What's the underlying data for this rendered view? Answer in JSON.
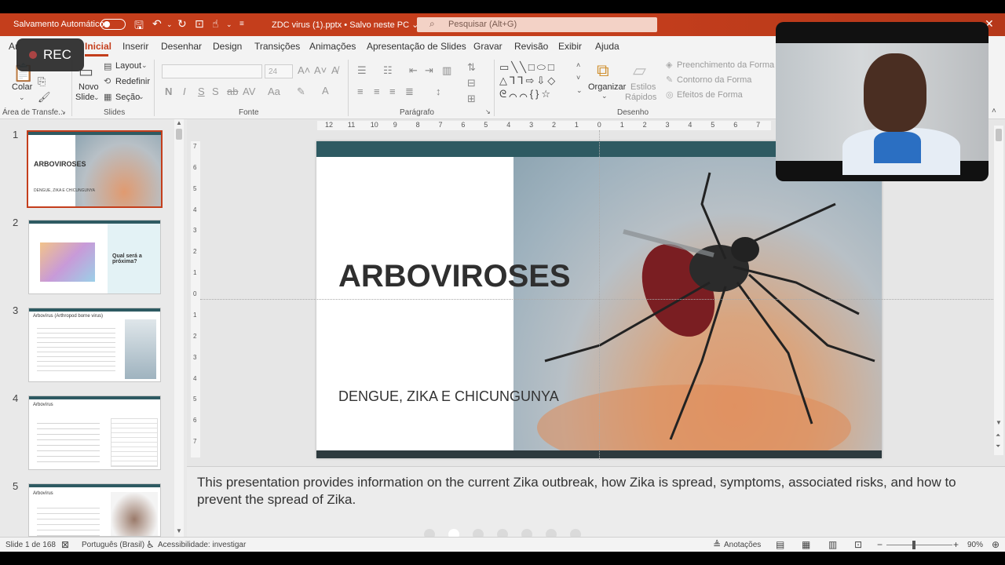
{
  "titlebar": {
    "autosave_label": "Salvamento Automático",
    "filename": "ZDC virus (1).pptx • Salvo neste PC ⌄",
    "search_placeholder": "Pesquisar (Alt+G)"
  },
  "tabs": [
    {
      "label": "Ar"
    },
    {
      "label": "Inicial"
    },
    {
      "label": "Inserir"
    },
    {
      "label": "Desenhar"
    },
    {
      "label": "Design"
    },
    {
      "label": "Transições"
    },
    {
      "label": "Animações"
    },
    {
      "label": "Apresentação de Slides"
    },
    {
      "label": "Gravar"
    },
    {
      "label": "Revisão"
    },
    {
      "label": "Exibir"
    },
    {
      "label": "Ajuda"
    }
  ],
  "ribbon": {
    "clipboard": {
      "paste": "Colar",
      "group": "Área de Transfe..."
    },
    "slides": {
      "new_slide_1": "Novo",
      "new_slide_2": "Slide",
      "layout": "Layout",
      "reset": "Redefinir",
      "section": "Seção",
      "group": "Slides"
    },
    "font": {
      "size": "24",
      "group": "Fonte"
    },
    "paragraph": {
      "group": "Parágrafo"
    },
    "drawing": {
      "organize": "Organizar",
      "quick_styles_1": "Estilos",
      "quick_styles_2": "Rápidos",
      "fill": "Preenchimento da Forma",
      "outline": "Contorno da Forma",
      "effects": "Efeitos de Forma",
      "group": "Desenho"
    }
  },
  "rec_label": "REC",
  "thumbnails": [
    {
      "number": "1",
      "title": "ARBOVIROSES",
      "subtitle": "DENGUE, ZIKA E CHICUNGUNYA"
    },
    {
      "number": "2",
      "title": "Qual será a próxima?"
    },
    {
      "number": "3",
      "title": "Arbovírus (Arthropod borne virus)"
    },
    {
      "number": "4",
      "title": "Arbovírus"
    },
    {
      "number": "5",
      "title": "Arbovírus"
    }
  ],
  "ruler": {
    "h_ticks": [
      "12",
      "11",
      "10",
      "9",
      "8",
      "7",
      "6",
      "5",
      "4",
      "3",
      "2",
      "1",
      "0",
      "1",
      "2",
      "3",
      "4",
      "5",
      "6",
      "7"
    ],
    "v_ticks": [
      "7",
      "6",
      "5",
      "4",
      "3",
      "2",
      "1",
      "0",
      "1",
      "2",
      "3",
      "4",
      "5",
      "6",
      "7"
    ]
  },
  "slide": {
    "title": "ARBOVIROSES",
    "subtitle": "DENGUE, ZIKA E CHICUNGUNYA",
    "colors": {
      "top_bar": "#2e5a62",
      "bottom_bar": "#2d3a3e"
    }
  },
  "notes": {
    "text": "This presentation provides information on the current Zika outbreak, how Zika is spread, symptoms, associated risks, and how to prevent the spread of Zika."
  },
  "status": {
    "slide_counter": "Slide 1 de 168",
    "language": "Português (Brasil)",
    "accessibility": "Acessibilidade: investigar",
    "notes_button": "Anotações",
    "zoom": "90%"
  },
  "colors": {
    "accent": "#c43e1c"
  }
}
